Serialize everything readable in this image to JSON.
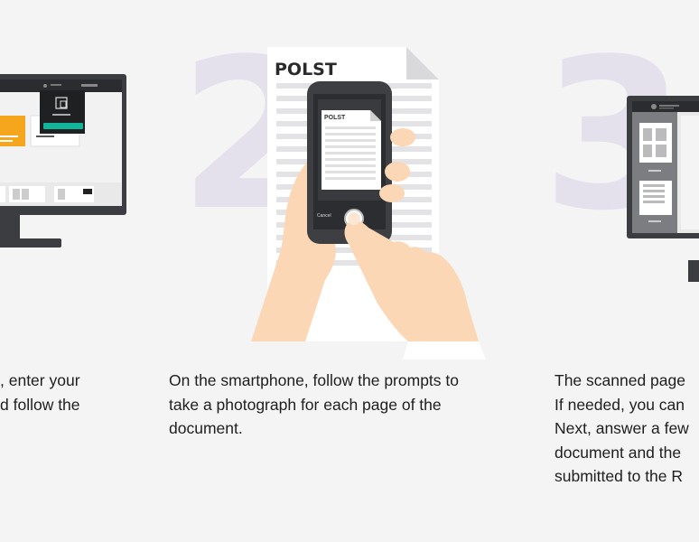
{
  "steps": [
    {
      "number": "",
      "caption": [
        ", enter your",
        "d follow the"
      ]
    },
    {
      "number": "2",
      "caption": [
        "On the smartphone, follow the prompts to",
        "take a photograph for each page of the",
        "document."
      ],
      "document_title": "POLST",
      "phone_doc_title": "POLST",
      "phone_cancel": "Cancel"
    },
    {
      "number": "3",
      "caption": [
        "The scanned page",
        "If needed, you can",
        "Next, answer a few",
        "document and the",
        "submitted to the R"
      ]
    }
  ],
  "colors": {
    "background": "#f4f4f5",
    "number_watermark": "#e4e0ec",
    "accent_teal": "#12b59a",
    "accent_orange": "#f6a61d",
    "skin": "#fbd7b6"
  }
}
